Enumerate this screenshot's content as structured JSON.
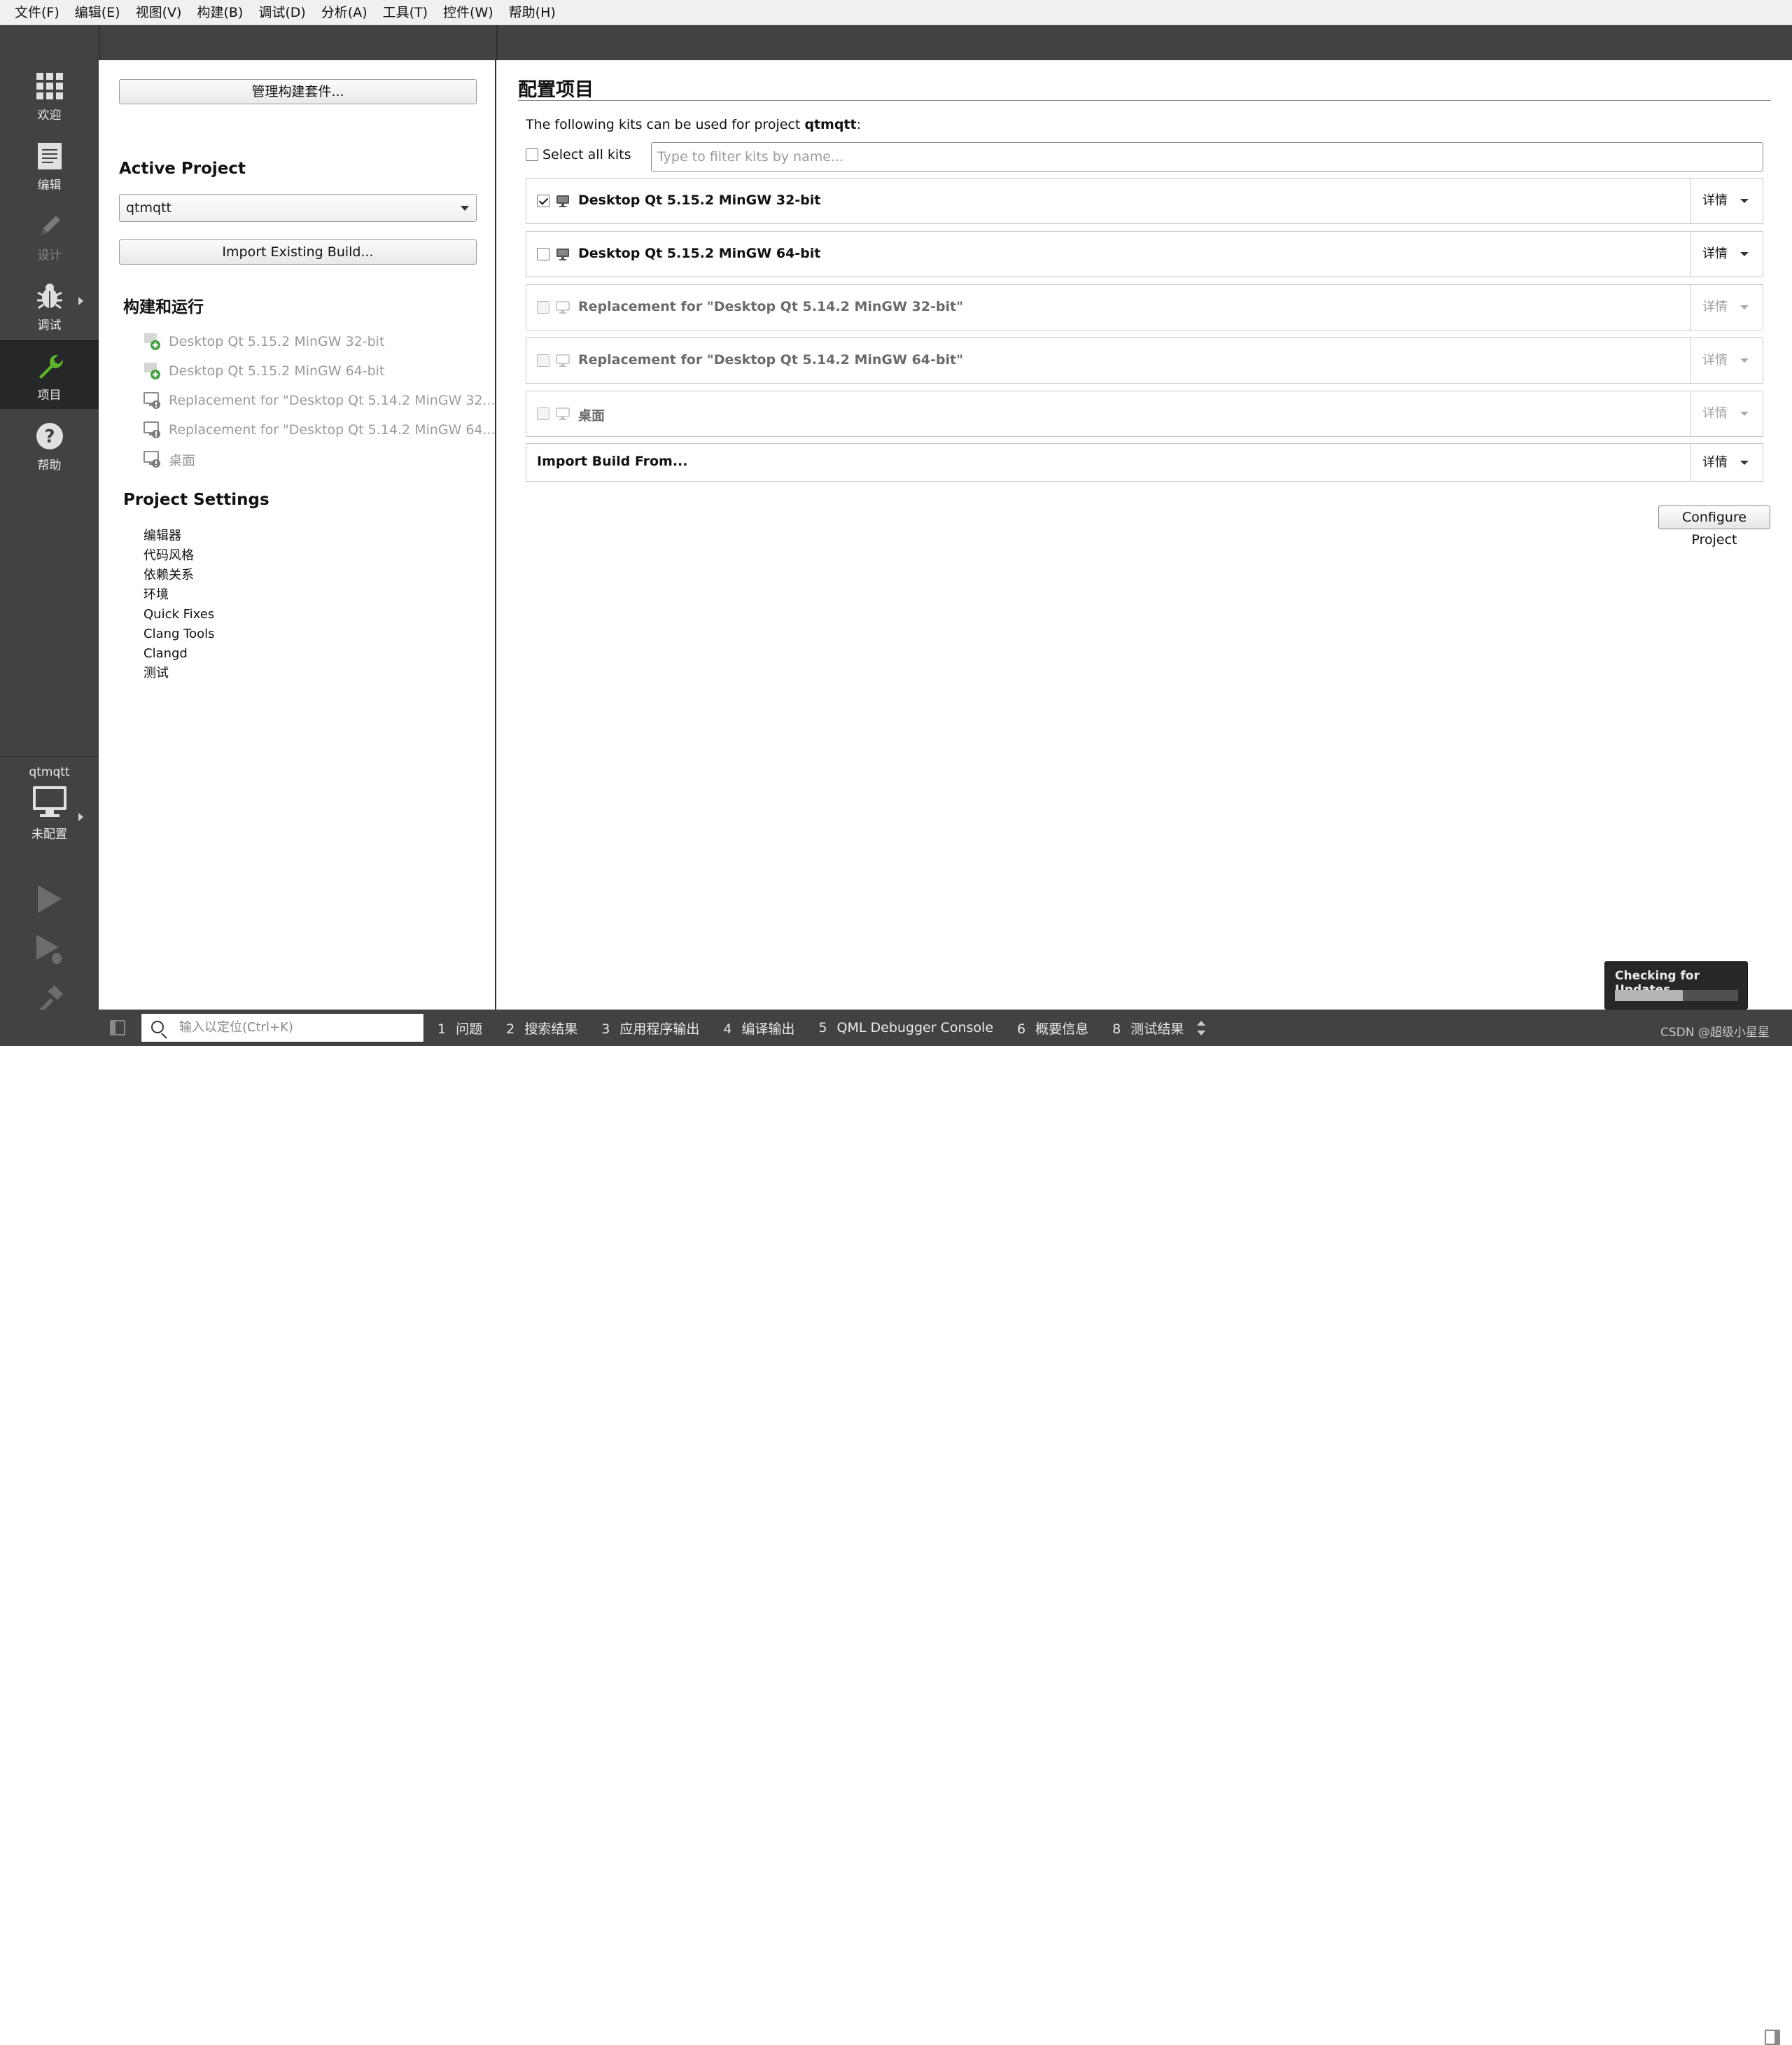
{
  "menu": [
    "文件(F)",
    "编辑(E)",
    "视图(V)",
    "构建(B)",
    "调试(D)",
    "分析(A)",
    "工具(T)",
    "控件(W)",
    "帮助(H)"
  ],
  "modes": [
    {
      "label": "欢迎",
      "icon": "grid-icon",
      "dim": false
    },
    {
      "label": "编辑",
      "icon": "document-icon",
      "dim": false
    },
    {
      "label": "设计",
      "icon": "pencil-icon",
      "dim": true
    },
    {
      "label": "调试",
      "icon": "bug-icon",
      "dim": false
    },
    {
      "label": "项目",
      "icon": "wrench-icon",
      "dim": false,
      "active": true
    },
    {
      "label": "帮助",
      "icon": "help-icon",
      "dim": false
    }
  ],
  "target": {
    "project": "qtmqtt",
    "status": "未配置"
  },
  "left": {
    "manage_kits_button": "管理构建套件...",
    "active_project_heading": "Active Project",
    "project_combo_value": "qtmqtt",
    "import_build_button": "Import Existing Build...",
    "build_run_heading": "构建和运行",
    "kits": [
      {
        "label": "Desktop Qt 5.15.2 MinGW 32-bit",
        "icon": "kit-add-icon"
      },
      {
        "label": "Desktop Qt 5.15.2 MinGW 64-bit",
        "icon": "kit-add-icon"
      },
      {
        "label": "Replacement for \"Desktop Qt 5.14.2 MinGW 32...",
        "icon": "kit-warning-icon"
      },
      {
        "label": "Replacement for \"Desktop Qt 5.14.2 MinGW 64...",
        "icon": "kit-warning-icon"
      },
      {
        "label": "桌面",
        "icon": "kit-warning-icon"
      }
    ],
    "project_settings_heading": "Project Settings",
    "settings": [
      "编辑器",
      "代码风格",
      "依赖关系",
      "环境",
      "Quick Fixes",
      "Clang Tools",
      "Clangd",
      "测试"
    ]
  },
  "main": {
    "title": "配置项目",
    "intro_prefix": "The following kits can be used for project ",
    "intro_project": "qtmqtt",
    "intro_suffix": ":",
    "select_all_label": "Select all kits",
    "filter_placeholder": "Type to filter kits by name...",
    "kits": [
      {
        "label": "Desktop Qt 5.15.2 MinGW 32-bit",
        "checked": true,
        "enabled": true,
        "details": "详情"
      },
      {
        "label": "Desktop Qt 5.15.2 MinGW 64-bit",
        "checked": false,
        "enabled": true,
        "details": "详情"
      },
      {
        "label": "Replacement for \"Desktop Qt 5.14.2 MinGW 32-bit\"",
        "checked": false,
        "enabled": false,
        "details": "详情"
      },
      {
        "label": "Replacement for \"Desktop Qt 5.14.2 MinGW 64-bit\"",
        "checked": false,
        "enabled": false,
        "details": "详情"
      },
      {
        "label": "桌面",
        "checked": false,
        "enabled": false,
        "details": "详情"
      }
    ],
    "import_from_label": "Import Build From...",
    "import_from_details": "详情",
    "configure_button": "Configure Project"
  },
  "update_popup": {
    "title": "Checking for Updates",
    "progress": 0.55
  },
  "statusbar": {
    "locator_placeholder": "输入以定位(Ctrl+K)",
    "tabs": [
      {
        "num": "1",
        "label": "问题"
      },
      {
        "num": "2",
        "label": "搜索结果"
      },
      {
        "num": "3",
        "label": "应用程序输出"
      },
      {
        "num": "4",
        "label": "编译输出"
      },
      {
        "num": "5",
        "label": "QML Debugger Console"
      },
      {
        "num": "6",
        "label": "概要信息"
      },
      {
        "num": "8",
        "label": "测试结果"
      }
    ]
  },
  "watermark": "CSDN @超级小星星"
}
